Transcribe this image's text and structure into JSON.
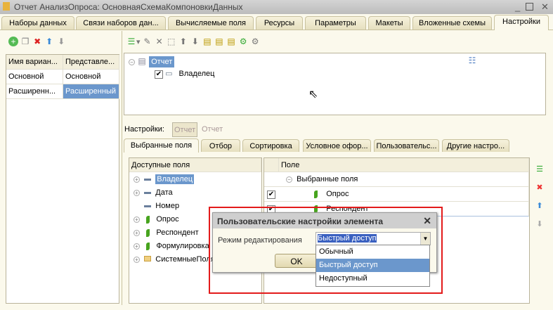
{
  "window": {
    "title": "Отчет АнализОпроса: ОсновнаяСхемаКомпоновкиДанных"
  },
  "tabs": [
    "Наборы данных",
    "Связи наборов дан...",
    "Вычисляемые поля",
    "Ресурсы",
    "Параметры",
    "Макеты",
    "Вложенные схемы",
    "Настройки"
  ],
  "variants": {
    "headers": [
      "Имя вариан...",
      "Представле..."
    ],
    "rows": [
      [
        "Основной",
        "Основной"
      ],
      [
        "Расширенн...",
        "Расширенный"
      ]
    ]
  },
  "tree": {
    "root": "Отчет",
    "child": "Владелец"
  },
  "settings": {
    "label": "Настройки:",
    "button": "Отчет",
    "value": "Отчет"
  },
  "inner_tabs": [
    "Выбранные поля",
    "Отбор",
    "Сортировка",
    "Условное офор...",
    "Пользовательс...",
    "Другие настро..."
  ],
  "available": {
    "header": "Доступные поля",
    "items": [
      "Владелец",
      "Дата",
      "Номер",
      "Опрос",
      "Респондент",
      "Формулировка",
      "СистемныеПоля"
    ]
  },
  "selected": {
    "header": "Поле",
    "group": "Выбранные поля",
    "items": [
      "Опрос",
      "Респондент"
    ]
  },
  "dialog": {
    "title": "Пользовательские настройки элемента",
    "label": "Режим редактирования",
    "value": "Быстрый доступ",
    "ok": "OK",
    "options": [
      "Обычный",
      "Быстрый доступ",
      "Недоступный"
    ]
  }
}
